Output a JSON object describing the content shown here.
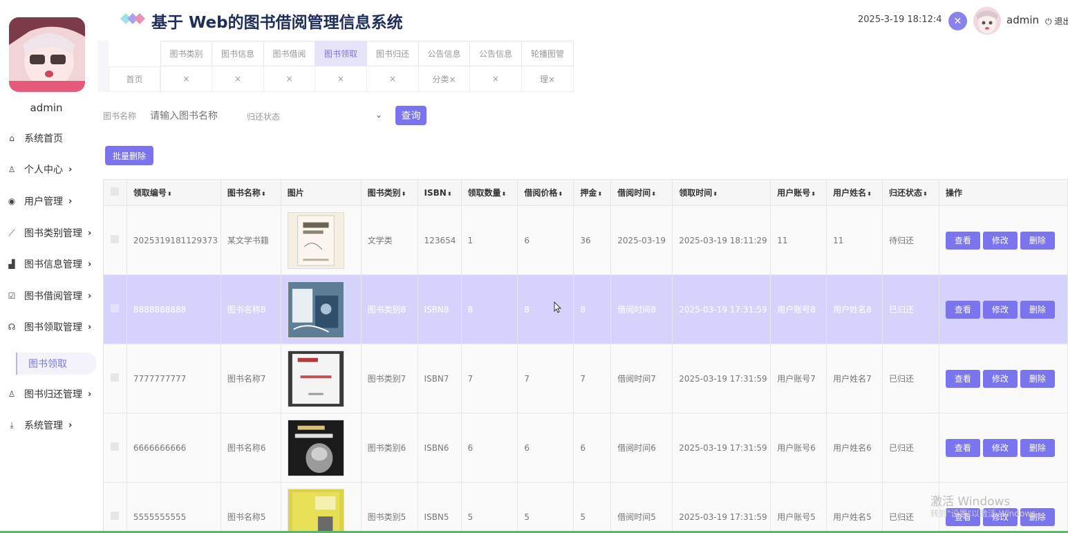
{
  "app": {
    "title": "基于 Web的图书借阅管理信息系统",
    "datetime": "2025-3-19 18:12:4",
    "username": "admin",
    "logout": "退出"
  },
  "sidebar": {
    "username": "admin",
    "items": [
      {
        "label": "系统首页",
        "icon": "home-icon"
      },
      {
        "label": "个人中心",
        "icon": "user-icon"
      },
      {
        "label": "用户管理",
        "icon": "target-icon"
      },
      {
        "label": "图书类别管理",
        "icon": "chart-line-icon"
      },
      {
        "label": "图书信息管理",
        "icon": "bar-chart-icon"
      },
      {
        "label": "图书借阅管理",
        "icon": "checklist-icon"
      },
      {
        "label": "图书领取管理",
        "icon": "hand-icon"
      },
      {
        "label": "图书归还管理",
        "icon": "person-icon"
      },
      {
        "label": "系统管理",
        "icon": "download-icon"
      }
    ],
    "submenu_active": "图书领取"
  },
  "tabs": {
    "top": [
      "图书类别",
      "图书信息",
      "图书借阅",
      "图书领取",
      "图书归还",
      "公告信息",
      "公告信息",
      "轮播图管"
    ],
    "active_index": 3,
    "bottom": [
      "首页",
      "×",
      "×",
      "×",
      "×",
      "×",
      "分类×",
      "×",
      "理×"
    ]
  },
  "search": {
    "label": "图书名称",
    "placeholder": "请输入图书名称",
    "status_placeholder": "归还状态",
    "query_button": "查询",
    "batch_delete": "批量删除"
  },
  "table": {
    "columns": [
      "领取编号",
      "图书名称",
      "图片",
      "图书类别",
      "ISBN",
      "领取数量",
      "借阅价格",
      "押金",
      "借阅时间",
      "领取时间",
      "用户账号",
      "用户姓名",
      "归还状态",
      "操作"
    ],
    "actions": [
      "查看",
      "修改",
      "删除"
    ],
    "rows": [
      {
        "id": "2025319181129373",
        "name": "某文学书籍",
        "category": "文学类",
        "isbn": "123654",
        "qty": "1",
        "price": "6",
        "deposit": "36",
        "borrow_time": "2025-03-19",
        "receive_time": "2025-03-19 18:11:29",
        "account": "11",
        "user_name": "11",
        "status": "待归还"
      },
      {
        "id": "8888888888",
        "name": "图书名称8",
        "category": "图书类别8",
        "isbn": "ISBN8",
        "qty": "8",
        "price": "8",
        "deposit": "8",
        "borrow_time": "借阅时间8",
        "receive_time": "2025-03-19 17:31:59",
        "account": "用户账号8",
        "user_name": "用户姓名8",
        "status": "已归还"
      },
      {
        "id": "7777777777",
        "name": "图书名称7",
        "category": "图书类别7",
        "isbn": "ISBN7",
        "qty": "7",
        "price": "7",
        "deposit": "7",
        "borrow_time": "借阅时间7",
        "receive_time": "2025-03-19 17:31:59",
        "account": "用户账号7",
        "user_name": "用户姓名7",
        "status": "已归还"
      },
      {
        "id": "6666666666",
        "name": "图书名称6",
        "category": "图书类别6",
        "isbn": "ISBN6",
        "qty": "6",
        "price": "6",
        "deposit": "6",
        "borrow_time": "借阅时间6",
        "receive_time": "2025-03-19 17:31:59",
        "account": "用户账号6",
        "user_name": "用户姓名6",
        "status": "已归还"
      },
      {
        "id": "5555555555",
        "name": "图书名称5",
        "category": "图书类别5",
        "isbn": "ISBN5",
        "qty": "5",
        "price": "5",
        "deposit": "5",
        "borrow_time": "借阅时间5",
        "receive_time": "2025-03-19 17:31:59",
        "account": "用户账号5",
        "user_name": "用户姓名5",
        "status": "已归还"
      }
    ]
  },
  "watermark": {
    "title": "激活 Windows",
    "subtitle": "转到\"设置\"以激活 Windows。"
  },
  "colors": {
    "accent": "#7a74ee",
    "highlight_row": "#d5d3fb",
    "title": "#1f2d5a"
  }
}
